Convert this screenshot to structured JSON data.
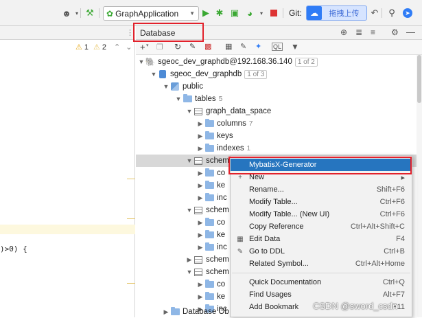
{
  "toolbar": {
    "run_config": "GraphApplication",
    "git_label": "Git:",
    "cloud_button": "拖拽上传",
    "colors": {
      "run": "#3aa832",
      "stop": "#d33",
      "cloud": "#2f7cf6"
    }
  },
  "editor": {
    "warning_count": "1",
    "weak_warning_count": "2",
    "code_fragment": ")>0) {"
  },
  "database_panel": {
    "title": "Database"
  },
  "tree": {
    "connection": {
      "label": "sgeoc_dev_graphdb@192.168.36.140",
      "badge": "1 of 2"
    },
    "database": {
      "label": "sgeoc_dev_graphdb",
      "badge": "1 of 3"
    },
    "schema": "public",
    "tables_folder": {
      "label": "tables",
      "count": "5"
    },
    "table1": "graph_data_space",
    "columns": {
      "label": "columns",
      "count": "7"
    },
    "keys": "keys",
    "indexes": {
      "label": "indexes",
      "count": "1"
    },
    "sel_table": "schem",
    "co": "co",
    "ke": "ke",
    "inc": "inc",
    "schem": "schem",
    "objects": "Database Ob"
  },
  "context_menu": {
    "items": [
      {
        "label": "MybatisX-Generator",
        "shortcut": ""
      },
      {
        "label": "New",
        "shortcut": ""
      },
      {
        "label": "Rename...",
        "shortcut": "Shift+F6"
      },
      {
        "label": "Modify Table...",
        "shortcut": "Ctrl+F6"
      },
      {
        "label": "Modify Table... (New UI)",
        "shortcut": "Ctrl+F6"
      },
      {
        "label": "Copy Reference",
        "shortcut": "Ctrl+Alt+Shift+C"
      },
      {
        "label": "Edit Data",
        "shortcut": "F4"
      },
      {
        "label": "Go to DDL",
        "shortcut": "Ctrl+B"
      },
      {
        "label": "Related Symbol...",
        "shortcut": "Ctrl+Alt+Home"
      },
      {
        "label": "Quick Documentation",
        "shortcut": "Ctrl+Q"
      },
      {
        "label": "Find Usages",
        "shortcut": "Alt+F7"
      },
      {
        "label": "Add Bookmark",
        "shortcut": "F11"
      }
    ]
  },
  "watermark": "CSDN @sword_csdn"
}
